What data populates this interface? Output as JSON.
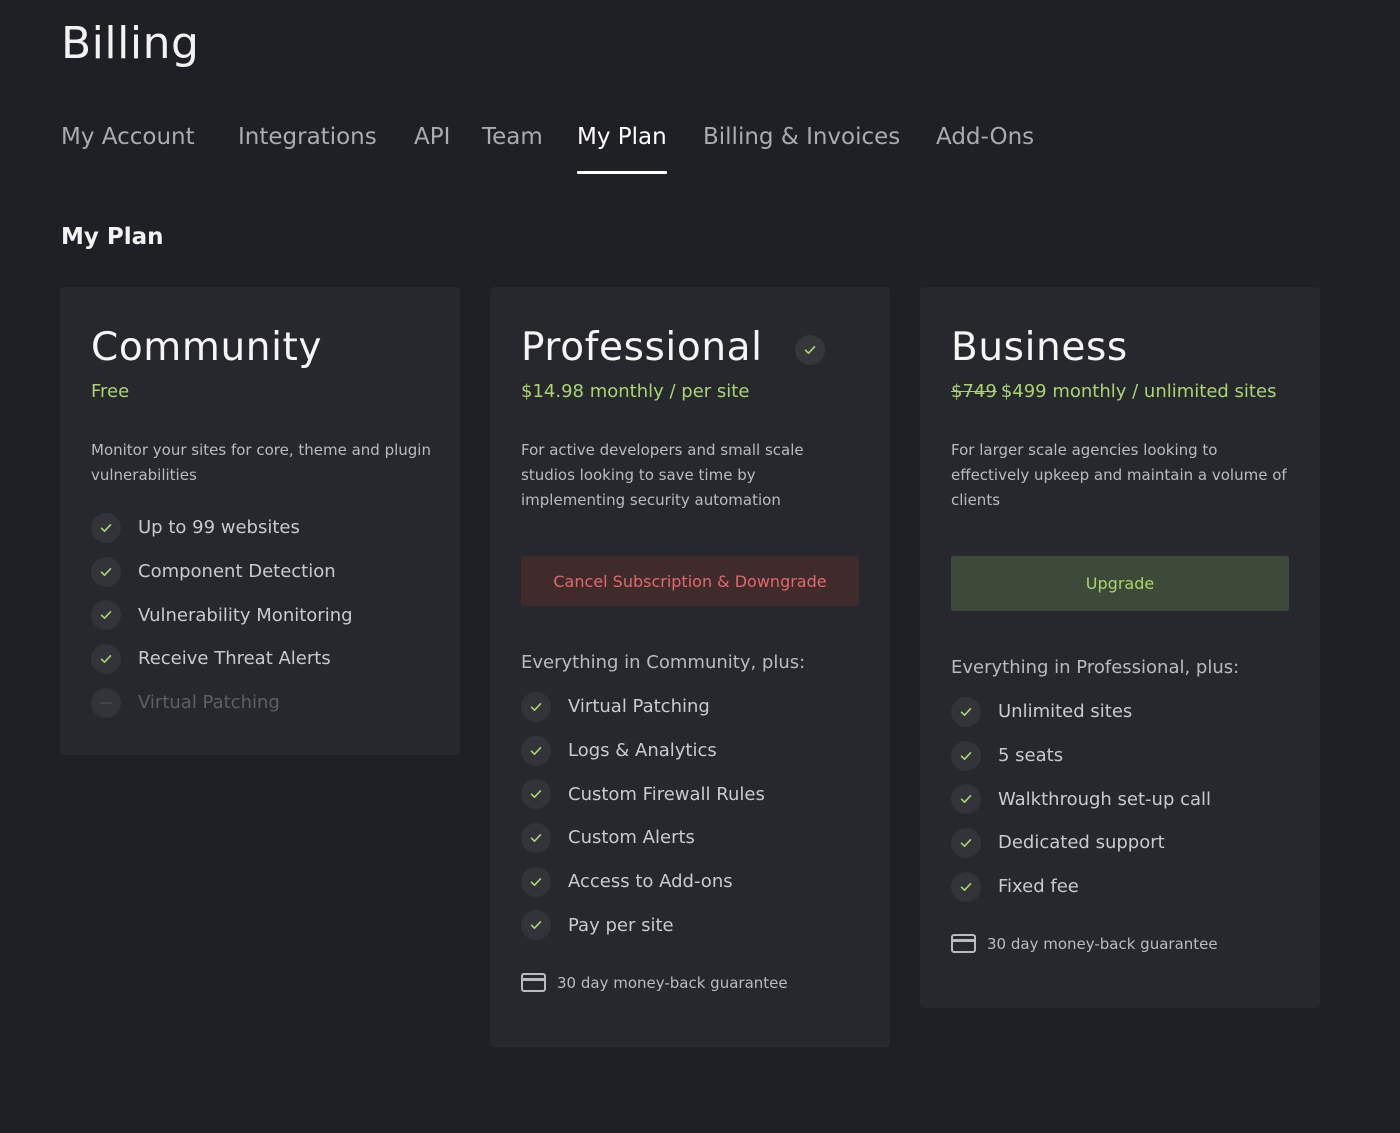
{
  "page": {
    "title": "Billing"
  },
  "tabs": [
    {
      "label": "My Account",
      "active": false
    },
    {
      "label": "Integrations",
      "active": false
    },
    {
      "label": "API",
      "active": false
    },
    {
      "label": "Team",
      "active": false
    },
    {
      "label": "My Plan",
      "active": true
    },
    {
      "label": "Billing & Invoices",
      "active": false
    },
    {
      "label": "Add-Ons",
      "active": false
    }
  ],
  "section": {
    "title": "My Plan"
  },
  "colors": {
    "background": "#1f2026",
    "card": "#27282e",
    "accent_green": "#a8d66c",
    "danger_red": "#e2696a"
  },
  "plans": {
    "community": {
      "name": "Community",
      "price": "Free",
      "description": "Monitor your sites for core, theme and plugin vulnerabilities",
      "features": [
        {
          "label": "Up to 99 websites",
          "included": true
        },
        {
          "label": "Component Detection",
          "included": true
        },
        {
          "label": "Vulnerability Monitoring",
          "included": true
        },
        {
          "label": "Receive Threat Alerts",
          "included": true
        },
        {
          "label": "Virtual Patching",
          "included": false
        }
      ]
    },
    "professional": {
      "name": "Professional",
      "current": true,
      "current_icon": "check-icon",
      "price": "$14.98 monthly / per site",
      "description": "For active developers and small scale studios looking to save time by implementing security automation",
      "button_label": "Cancel Subscription & Downgrade",
      "plus_label": "Everything in Community, plus:",
      "features": [
        {
          "label": "Virtual Patching",
          "included": true
        },
        {
          "label": "Logs & Analytics",
          "included": true
        },
        {
          "label": "Custom Firewall Rules",
          "included": true
        },
        {
          "label": "Custom Alerts",
          "included": true
        },
        {
          "label": "Access to Add-ons",
          "included": true
        },
        {
          "label": "Pay per site",
          "included": true
        }
      ],
      "guarantee": "30 day money-back guarantee"
    },
    "business": {
      "name": "Business",
      "old_price": "$749",
      "price": "$499 monthly / unlimited sites",
      "description": "For larger scale agencies looking to effectively upkeep and maintain a volume of clients",
      "button_label": "Upgrade",
      "plus_label": "Everything in Professional, plus:",
      "features": [
        {
          "label": "Unlimited sites",
          "included": true
        },
        {
          "label": "5 seats",
          "included": true
        },
        {
          "label": "Walkthrough set-up call",
          "included": true
        },
        {
          "label": "Dedicated support",
          "included": true
        },
        {
          "label": "Fixed fee",
          "included": true
        }
      ],
      "guarantee": "30 day money-back guarantee"
    }
  }
}
